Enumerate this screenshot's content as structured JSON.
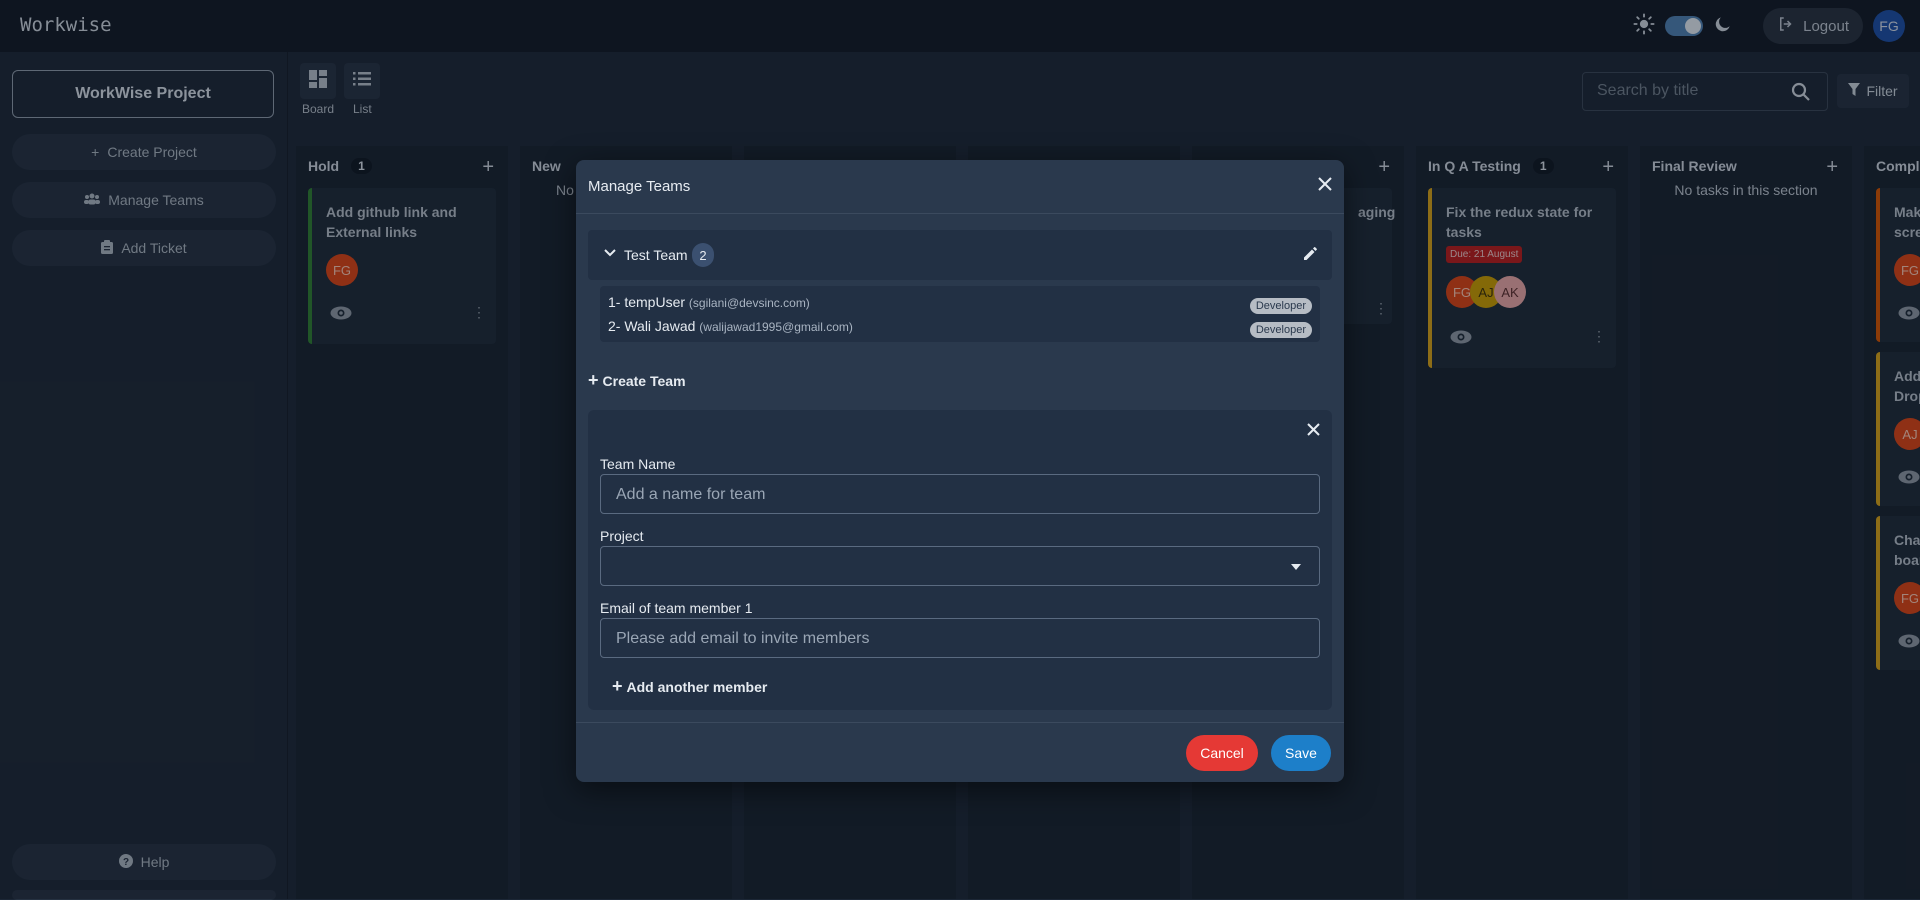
{
  "app": {
    "brand": "Workwise"
  },
  "header": {
    "logout_label": "Logout",
    "avatar_initials": "FG"
  },
  "sidebar": {
    "project_name": "WorkWise Project",
    "create_project": "Create Project",
    "manage_teams": "Manage Teams",
    "add_ticket": "Add Ticket",
    "help": "Help"
  },
  "toolbar": {
    "board_label": "Board",
    "list_label": "List",
    "search_placeholder": "Search by title",
    "filter_label": "Filter"
  },
  "columns": [
    {
      "title": "Hold",
      "count": "1"
    },
    {
      "title": "New",
      "empty_text": "No"
    },
    {
      "title": "In Q A Testing",
      "count": "1"
    },
    {
      "title": "Final Review",
      "empty_text": "No tasks in this section"
    },
    {
      "title": "Compl"
    }
  ],
  "cards": {
    "hold_card": {
      "title": "Add github link and External links",
      "avatar": "FG"
    },
    "partial_card_title": "aging",
    "qa_card": {
      "title": "Fix the redux state for tasks",
      "due": "Due: 21 August",
      "avatars": [
        "FG",
        "AJ",
        "AK"
      ]
    },
    "right_cards": [
      {
        "title": "Mak\nscre",
        "avatar": "FG"
      },
      {
        "title": "Add\nDrop",
        "avatar": "AJ"
      },
      {
        "title": "Cha\nboar",
        "avatar": "FG"
      }
    ]
  },
  "modal": {
    "title": "Manage Teams",
    "team": {
      "name": "Test Team",
      "count": "2"
    },
    "members": [
      {
        "index": "1-",
        "name": "tempUser",
        "email": "(sgilani@devsinc.com)",
        "role": "Developer"
      },
      {
        "index": "2-",
        "name": "Wali Jawad",
        "email": "(walijawad1995@gmail.com)",
        "role": "Developer"
      }
    ],
    "create_team_label": "Create Team",
    "form": {
      "team_name_label": "Team Name",
      "team_name_placeholder": "Add a name for team",
      "project_label": "Project",
      "project_value": "",
      "email_label": "Email of team member 1",
      "email_placeholder": "Please add email to invite members",
      "add_member_label": "Add another member"
    },
    "cancel_label": "Cancel",
    "save_label": "Save"
  },
  "colors": {
    "hold_border": "#2e7d32",
    "qa_border": "#d4a017",
    "cancel": "#e53935",
    "save": "#1d7fc9",
    "due_badge": "#b71c1c"
  }
}
